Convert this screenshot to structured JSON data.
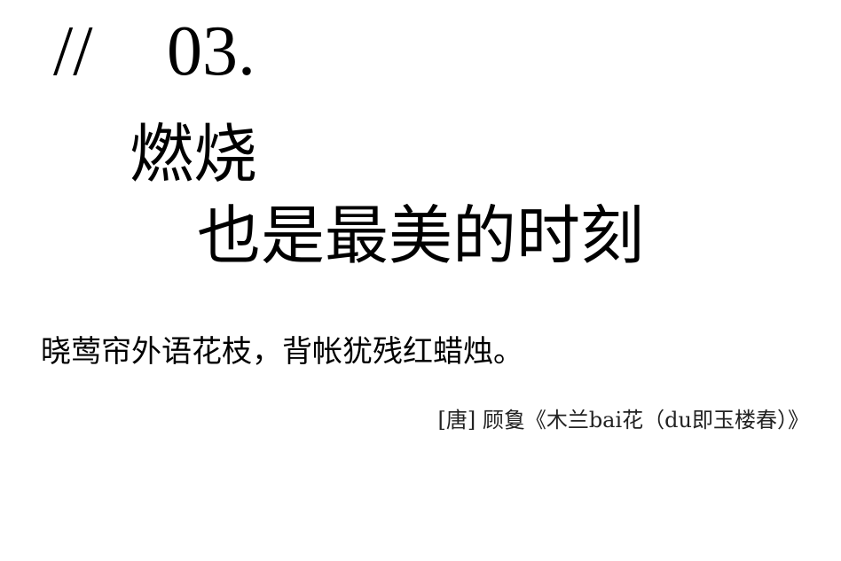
{
  "section": {
    "mark": "//",
    "number": "03."
  },
  "headline": {
    "line1": "燃烧",
    "line2": "也是最美的时刻"
  },
  "verse": {
    "text": "晓莺帘外语花枝，背帐犹残红蜡烛。",
    "attribution": "[唐] 顾敻《木兰bai花（du即玉楼春）》"
  }
}
